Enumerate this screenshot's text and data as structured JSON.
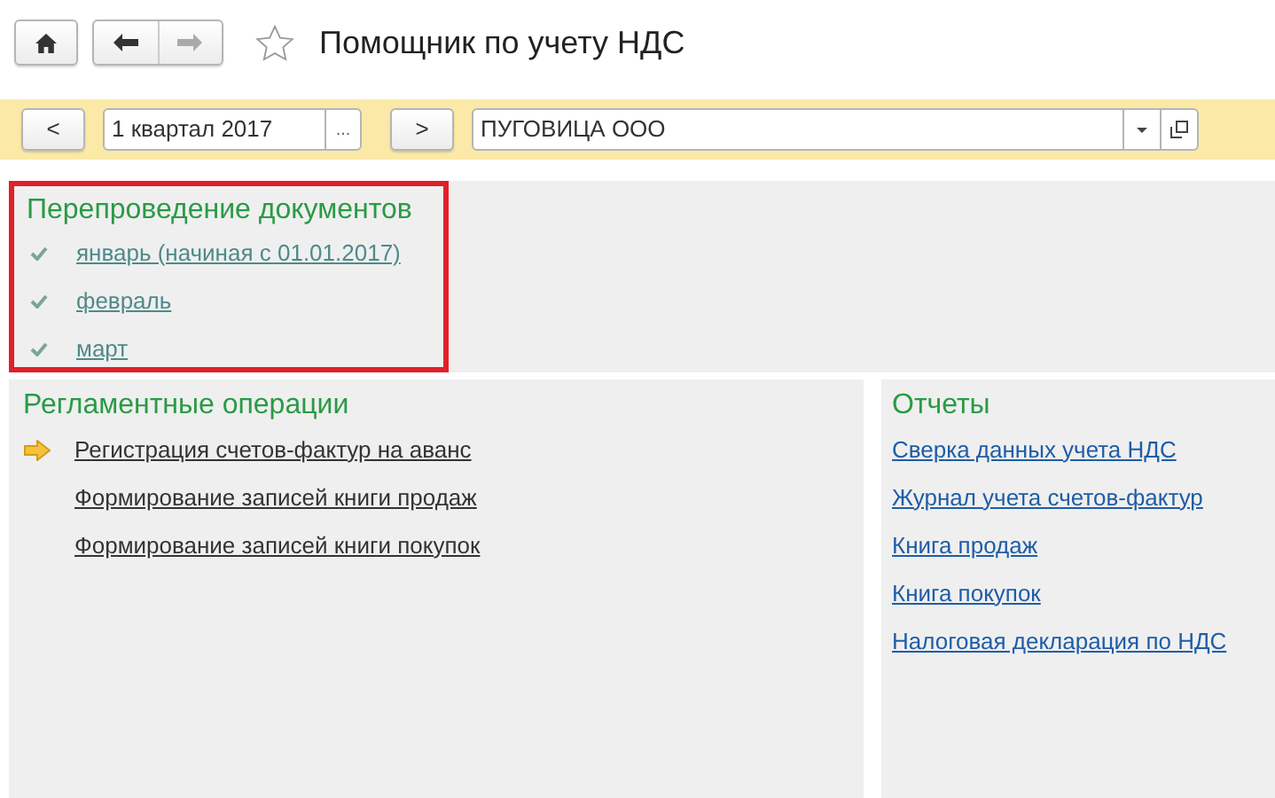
{
  "window": {
    "title": "Помощник по учету НДС",
    "favorite": false
  },
  "toolbar": {
    "prev": "<",
    "period": "1 квартал 2017",
    "period_choose": "...",
    "next": ">",
    "organization": "ПУГОВИЦА ООО"
  },
  "reposting": {
    "title": "Перепроведение документов",
    "highlighted": true,
    "items": [
      {
        "label": "январь (начиная с 01.01.2017)",
        "checked": true
      },
      {
        "label": "февраль",
        "checked": true
      },
      {
        "label": "март",
        "checked": true
      }
    ]
  },
  "operations": {
    "title": "Регламентные операции",
    "items": [
      {
        "label": "Регистрация счетов-фактур на аванс",
        "current": true
      },
      {
        "label": "Формирование записей книги продаж",
        "current": false
      },
      {
        "label": "Формирование записей книги покупок",
        "current": false
      }
    ]
  },
  "reports": {
    "title": "Отчеты",
    "items": [
      "Сверка данных учета НДС",
      "Журнал учета счетов-фактур",
      "Книга продаж",
      "Книга покупок",
      "Налоговая декларация по НДС"
    ]
  }
}
